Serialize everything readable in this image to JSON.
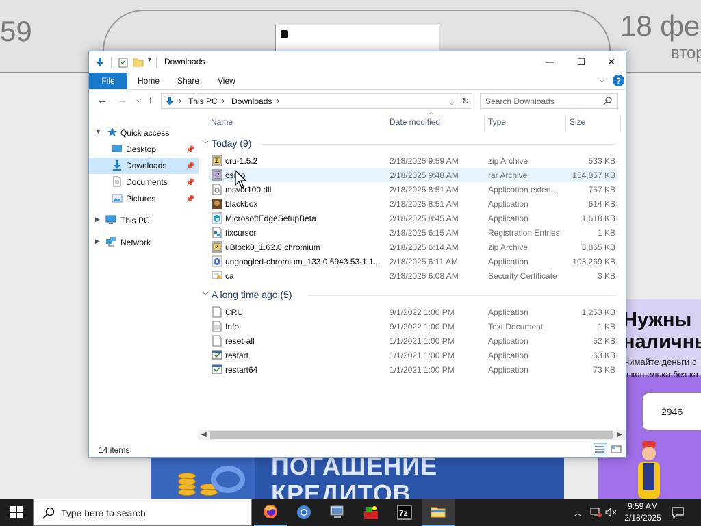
{
  "background_page": {
    "time_fragment": "59",
    "date_fragment": "18 фе",
    "weekday_fragment": "втор",
    "ad_bottom": {
      "line1": "ПОГАШЕНИЕ",
      "line2": "КРЕДИТОВ"
    },
    "ad_right": {
      "title1": "Нужны",
      "title2": "наличны",
      "sub1": "нимайте деньги с",
      "sub2": "з кошелька без ка",
      "card_number": "2946"
    }
  },
  "window": {
    "title": "Downloads",
    "controls": {
      "minimize": "—",
      "maximize": "☐",
      "close": "✕"
    }
  },
  "ribbon": {
    "tabs": [
      "File",
      "Home",
      "Share",
      "View"
    ],
    "help": "?"
  },
  "navbar": {
    "breadcrumb": [
      "This PC",
      "Downloads"
    ],
    "search_placeholder": "Search Downloads"
  },
  "nav_pane": {
    "quick_access": "Quick access",
    "items": [
      {
        "label": "Desktop",
        "pinned": true
      },
      {
        "label": "Downloads",
        "pinned": true,
        "selected": true
      },
      {
        "label": "Documents",
        "pinned": true
      },
      {
        "label": "Pictures",
        "pinned": true
      }
    ],
    "this_pc": "This PC",
    "network": "Network"
  },
  "columns": [
    "Name",
    "Date modified",
    "Type",
    "Size"
  ],
  "groups": [
    {
      "label": "Today (9)",
      "files": [
        {
          "name": "cru-1.5.2",
          "date": "2/18/2025 9:59 AM",
          "type": "zip Archive",
          "size": "533 KB",
          "icon": "zip-archive-icon"
        },
        {
          "name": "osmo",
          "date": "2/18/2025 9:48 AM",
          "type": "rar Archive",
          "size": "154,857 KB",
          "icon": "rar-archive-icon"
        },
        {
          "name": "msvcr100.dll",
          "date": "2/18/2025 8:51 AM",
          "type": "Application exten...",
          "size": "757 KB",
          "icon": "dll-file-icon"
        },
        {
          "name": "blackbox",
          "date": "2/18/2025 8:51 AM",
          "type": "Application",
          "size": "614 KB",
          "icon": "blackbox-app-icon"
        },
        {
          "name": "MicrosoftEdgeSetupBeta",
          "date": "2/18/2025 8:45 AM",
          "type": "Application",
          "size": "1,618 KB",
          "icon": "edge-setup-icon"
        },
        {
          "name": "fixcursor",
          "date": "2/18/2025 6:15 AM",
          "type": "Registration Entries",
          "size": "1 KB",
          "icon": "registry-file-icon"
        },
        {
          "name": "uBlock0_1.62.0.chromium",
          "date": "2/18/2025 6:14 AM",
          "type": "zip Archive",
          "size": "3,865 KB",
          "icon": "zip-archive-icon"
        },
        {
          "name": "ungoogled-chromium_133.0.6943.53-1.1...",
          "date": "2/18/2025 6:11 AM",
          "type": "Application",
          "size": "103,269 KB",
          "icon": "chromium-installer-icon"
        },
        {
          "name": "ca",
          "date": "2/18/2025 6:08 AM",
          "type": "Security Certificate",
          "size": "3 KB",
          "icon": "certificate-icon"
        }
      ]
    },
    {
      "label": "A long time ago (5)",
      "files": [
        {
          "name": "CRU",
          "date": "9/1/2022 1:00 PM",
          "type": "Application",
          "size": "1,253 KB",
          "icon": "blank-file-icon"
        },
        {
          "name": "Info",
          "date": "9/1/2022 1:00 PM",
          "type": "Text Document",
          "size": "1 KB",
          "icon": "text-file-icon"
        },
        {
          "name": "reset-all",
          "date": "1/1/2021 1:00 PM",
          "type": "Application",
          "size": "52 KB",
          "icon": "blank-file-icon"
        },
        {
          "name": "restart",
          "date": "1/1/2021 1:00 PM",
          "type": "Application",
          "size": "63 KB",
          "icon": "app-window-icon"
        },
        {
          "name": "restart64",
          "date": "1/1/2021 1:00 PM",
          "type": "Application",
          "size": "73 KB",
          "icon": "app-window-icon"
        }
      ]
    }
  ],
  "status": {
    "count_text": "14 items"
  },
  "taskbar": {
    "search_text": "Type here to search",
    "apps": [
      "firefox-icon",
      "chrome-icon",
      "computer-icon",
      "app-icon",
      "7zip-icon",
      "file-explorer-icon"
    ],
    "clock_time": "9:59 AM",
    "clock_date": "2/18/2025"
  },
  "colors": {
    "accent": "#1979ca",
    "selection": "#cce8ff",
    "hover": "#e5f3ff",
    "group_text": "#1e3a78"
  }
}
